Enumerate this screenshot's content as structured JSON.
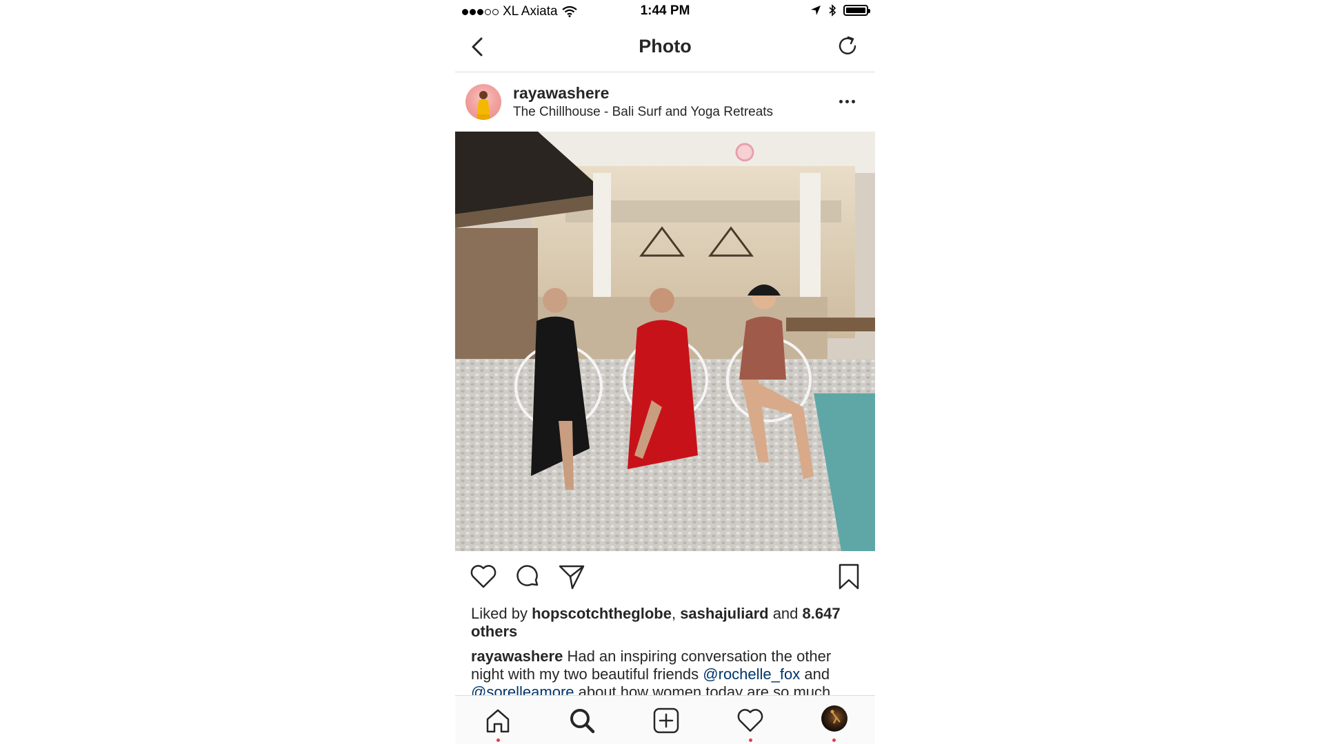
{
  "status_bar": {
    "carrier": "XL Axiata",
    "time": "1:44 PM",
    "signal_bars_filled": 3,
    "signal_bars_total": 5,
    "battery_level": 1.0
  },
  "nav": {
    "title": "Photo",
    "back_icon": "chevron-left-icon",
    "refresh_icon": "refresh-icon"
  },
  "post": {
    "username": "rayawashere",
    "location": "The Chillhouse - Bali Surf and Yoga Retreats",
    "photo_alt": "Three women seated on white chairs on a patio",
    "likes": {
      "prefix": "Liked by ",
      "user1": "hopscotchtheglobe",
      "separator": ", ",
      "user2": "sashajuliard",
      "connector": " and ",
      "others": "8.647 others"
    },
    "caption": {
      "author": "rayawashere",
      "text_1": " Had an inspiring conversation the other night with my two beautiful friends ",
      "mention_1": "@rochelle_fox",
      "text_2": " and ",
      "mention_2": "@sorelleamore",
      "text_3": " about how women today are so much"
    }
  },
  "tab_bar": {
    "items": [
      "home-icon",
      "search-icon",
      "add-post-icon",
      "activity-heart-icon",
      "profile-avatar"
    ]
  },
  "colors": {
    "notification_dot": "#e8384f",
    "mention": "#003569",
    "text": "#262626",
    "divider": "#dbdbdb"
  }
}
